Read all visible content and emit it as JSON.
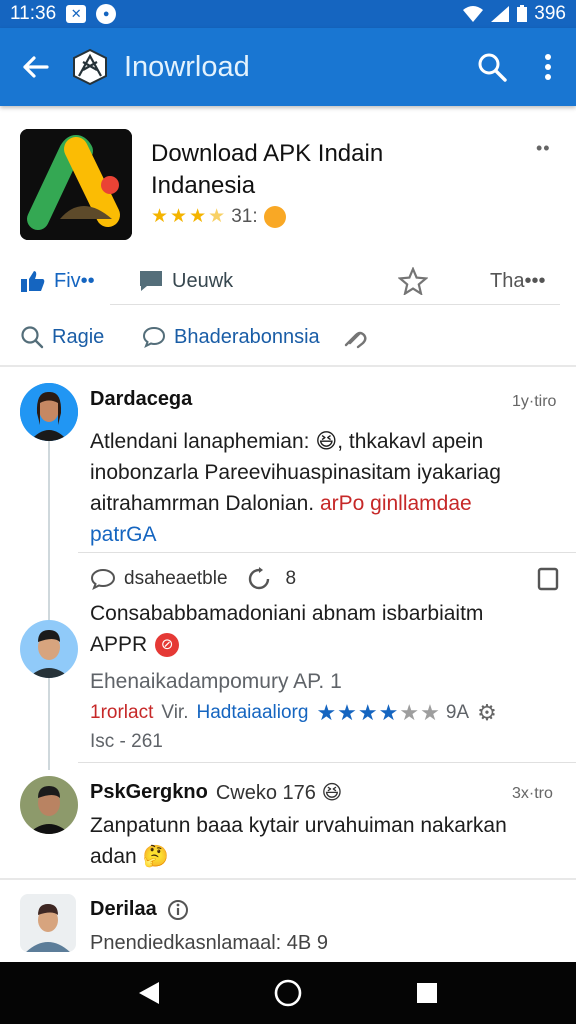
{
  "status_bar": {
    "time": "11:36",
    "battery": "396"
  },
  "app_bar": {
    "title": "Inowrload"
  },
  "app": {
    "name_line1": "Download APK Indain",
    "name_line2": "Indanesia",
    "rating_text": "31:",
    "more": "••"
  },
  "actions": {
    "like_label": "Fiv••",
    "review_label": "Ueuwk",
    "share_label": "Tha•••"
  },
  "filters": {
    "search_label": "Ragie",
    "chat_label": "Bhaderabonnsia"
  },
  "comments": [
    {
      "user": "Dardacega",
      "time": "1y·tiro",
      "line1": "Atlendani lanaphemian: 😆, thkakavl apein",
      "line2": "inobonzarla Pareevihuaspinasitam iyakariag",
      "line3a": "aitrahamrman Dalonian. ",
      "line3b": "arPo ginllamdae",
      "line4": "patrGA"
    },
    {
      "meta_label": "dsaheaetble",
      "meta_count": "8",
      "title": "Consababbamadoniani abnam isbarbiaitm",
      "title2": "APPR",
      "sub": "Ehenaikadampomury AP. 1",
      "tag_red": "1rorlact",
      "tag_gray": "Vir.",
      "tag_blue": "Hadtaiaaliorg",
      "rating_value": "9A",
      "date": "Isc - 261"
    },
    {
      "user": "PskGergkno",
      "user_extra": "Cweko 176 😆",
      "time": "3x·tro",
      "line1": "Zanpatunn baaa kytair urvahuiman nakarkan",
      "line2": "adan 🤔"
    },
    {
      "user": "Derilaa",
      "text": "Pnendiedkasnlamaal: 4B 9"
    }
  ],
  "colors": {
    "primary": "#1976d2",
    "status": "#1565c0",
    "star": "#f4b400",
    "link": "#1565c0",
    "alert": "#c62828"
  }
}
